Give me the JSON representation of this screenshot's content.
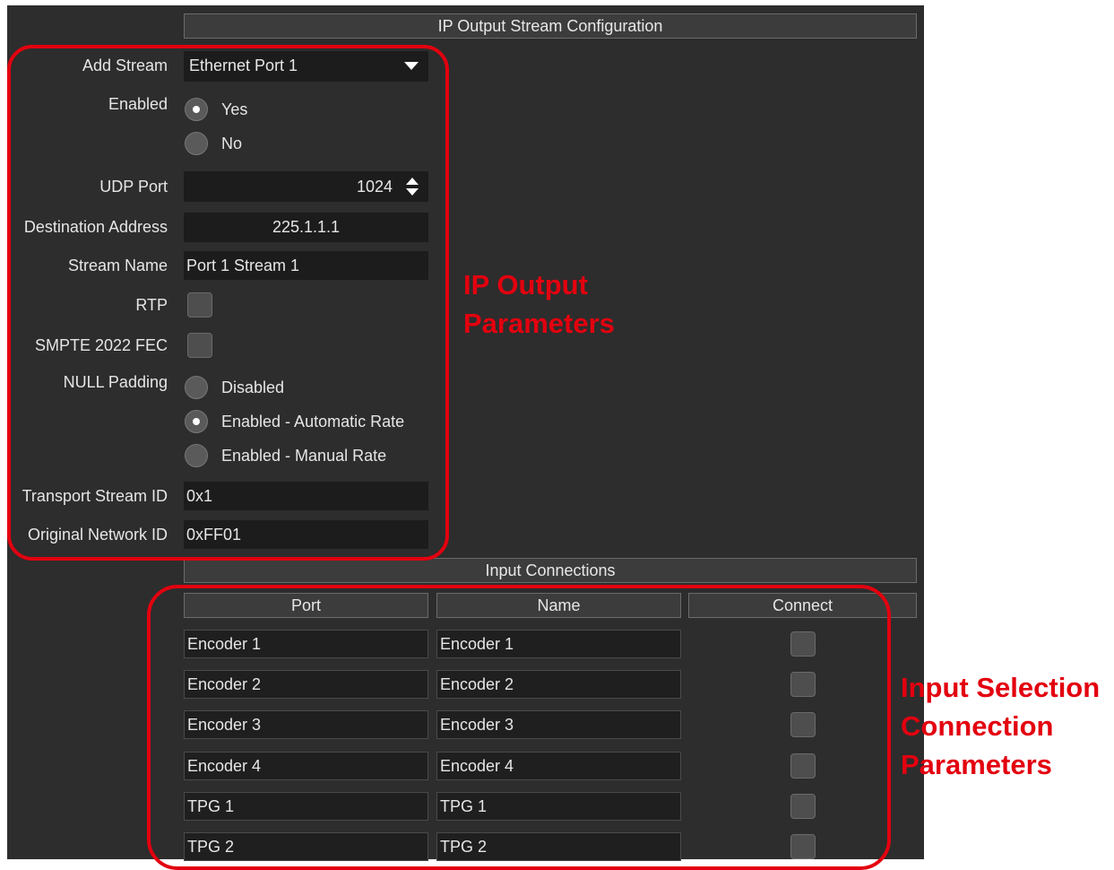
{
  "config": {
    "title": "IP Output Stream Configuration",
    "add_stream": {
      "label": "Add Stream",
      "value": "Ethernet Port 1"
    },
    "enabled": {
      "label": "Enabled",
      "options": [
        "Yes",
        "No"
      ],
      "selected": "Yes"
    },
    "udp_port": {
      "label": "UDP Port",
      "value": "1024"
    },
    "destination_address": {
      "label": "Destination Address",
      "value": "225.1.1.1"
    },
    "stream_name": {
      "label": "Stream Name",
      "value": "Port 1 Stream 1"
    },
    "rtp": {
      "label": "RTP",
      "checked": false
    },
    "fec": {
      "label": "SMPTE 2022 FEC",
      "checked": false
    },
    "null_padding": {
      "label": "NULL Padding",
      "options": [
        "Disabled",
        "Enabled - Automatic Rate",
        "Enabled - Manual Rate"
      ],
      "selected": "Enabled - Automatic Rate"
    },
    "transport_stream_id": {
      "label": "Transport Stream ID",
      "value": "0x1"
    },
    "original_network_id": {
      "label": "Original Network ID",
      "value": "0xFF01"
    }
  },
  "inputs": {
    "title": "Input Connections",
    "columns": [
      "Port",
      "Name",
      "Connect"
    ],
    "rows": [
      {
        "port": "Encoder 1",
        "name": "Encoder 1",
        "connected": false
      },
      {
        "port": "Encoder 2",
        "name": "Encoder 2",
        "connected": false
      },
      {
        "port": "Encoder 3",
        "name": "Encoder 3",
        "connected": false
      },
      {
        "port": "Encoder 4",
        "name": "Encoder 4",
        "connected": false
      },
      {
        "port": "TPG 1",
        "name": "TPG 1",
        "connected": false
      },
      {
        "port": "TPG 2",
        "name": "TPG 2",
        "connected": false
      }
    ]
  },
  "annotations": {
    "ip_output": [
      "IP Output",
      "Parameters"
    ],
    "input_selection": [
      "Input Selection",
      "Connection",
      "Parameters"
    ]
  },
  "colors": {
    "panel": "#2d2d2d",
    "annotation": "#e3000f"
  },
  "icons": {
    "dropdown": "caret-down-icon",
    "spinner": "up-down-arrows-icon"
  }
}
